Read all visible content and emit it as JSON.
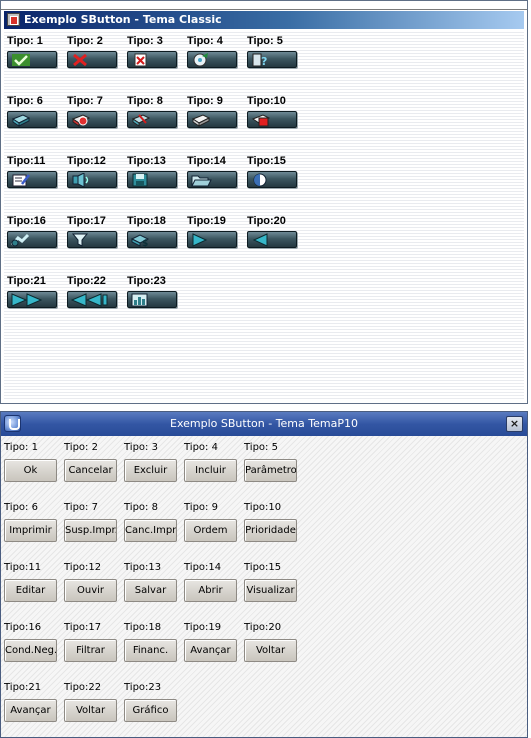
{
  "classic_window": {
    "title": "Exemplo SButton - Tema Classic",
    "buttons": [
      {
        "label": "Tipo: 1",
        "icon": "check-icon"
      },
      {
        "label": "Tipo: 2",
        "icon": "cancel-x-icon"
      },
      {
        "label": "Tipo: 3",
        "icon": "delete-document-icon"
      },
      {
        "label": "Tipo: 4",
        "icon": "include-disk-icon"
      },
      {
        "label": "Tipo: 5",
        "icon": "parameters-help-icon"
      },
      {
        "label": "Tipo: 6",
        "icon": "printer-icon"
      },
      {
        "label": "Tipo: 7",
        "icon": "print-suspend-icon"
      },
      {
        "label": "Tipo: 8",
        "icon": "print-cancel-icon"
      },
      {
        "label": "Tipo: 9",
        "icon": "order-icon"
      },
      {
        "label": "Tipo:10",
        "icon": "priority-icon"
      },
      {
        "label": "Tipo:11",
        "icon": "edit-icon"
      },
      {
        "label": "Tipo:12",
        "icon": "listen-speaker-icon"
      },
      {
        "label": "Tipo:13",
        "icon": "save-icon"
      },
      {
        "label": "Tipo:14",
        "icon": "open-folder-icon"
      },
      {
        "label": "Tipo:15",
        "icon": "view-icon"
      },
      {
        "label": "Tipo:16",
        "icon": "negotiation-icon"
      },
      {
        "label": "Tipo:17",
        "icon": "filter-icon"
      },
      {
        "label": "Tipo:18",
        "icon": "finance-money-icon"
      },
      {
        "label": "Tipo:19",
        "icon": "play-forward-icon"
      },
      {
        "label": "Tipo:20",
        "icon": "play-back-icon"
      },
      {
        "label": "Tipo:21",
        "icon": "fast-forward-icon"
      },
      {
        "label": "Tipo:22",
        "icon": "rewind-icon"
      },
      {
        "label": "Tipo:23",
        "icon": "chart-icon"
      }
    ]
  },
  "p10_window": {
    "title": "Exemplo SButton - Tema TemaP10",
    "close_label": "×",
    "buttons": [
      {
        "label": "Tipo: 1",
        "text": "Ok"
      },
      {
        "label": "Tipo: 2",
        "text": "Cancelar"
      },
      {
        "label": "Tipo: 3",
        "text": "Excluir"
      },
      {
        "label": "Tipo: 4",
        "text": "Incluir"
      },
      {
        "label": "Tipo: 5",
        "text": "Parâmetros"
      },
      {
        "label": "Tipo: 6",
        "text": "Imprimir"
      },
      {
        "label": "Tipo: 7",
        "text": "Susp.Impr."
      },
      {
        "label": "Tipo: 8",
        "text": "Canc.Impr."
      },
      {
        "label": "Tipo: 9",
        "text": "Ordem"
      },
      {
        "label": "Tipo:10",
        "text": "Prioridade"
      },
      {
        "label": "Tipo:11",
        "text": "Editar"
      },
      {
        "label": "Tipo:12",
        "text": "Ouvir"
      },
      {
        "label": "Tipo:13",
        "text": "Salvar"
      },
      {
        "label": "Tipo:14",
        "text": "Abrir"
      },
      {
        "label": "Tipo:15",
        "text": "Visualizar"
      },
      {
        "label": "Tipo:16",
        "text": "Cond.Neg."
      },
      {
        "label": "Tipo:17",
        "text": "Filtrar"
      },
      {
        "label": "Tipo:18",
        "text": "Financ."
      },
      {
        "label": "Tipo:19",
        "text": "Avançar"
      },
      {
        "label": "Tipo:20",
        "text": "Voltar"
      },
      {
        "label": "Tipo:21",
        "text": "Avançar"
      },
      {
        "label": "Tipo:22",
        "text": "Voltar"
      },
      {
        "label": "Tipo:23",
        "text": "Gráfico"
      }
    ]
  }
}
